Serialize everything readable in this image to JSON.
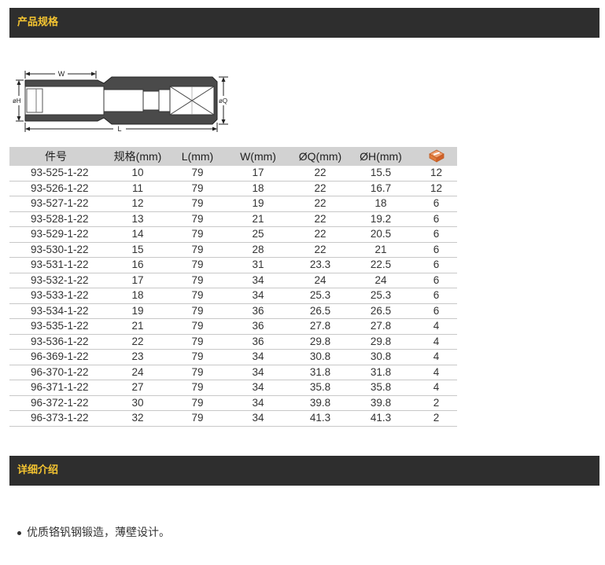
{
  "sections": {
    "spec_title": "产品规格",
    "detail_title": "详细介绍"
  },
  "diagram": {
    "label_w": "W",
    "label_l": "L",
    "label_h": "øH",
    "label_q": "øQ"
  },
  "table": {
    "headers": [
      "件号",
      "规格(mm)",
      "L(mm)",
      "W(mm)",
      "ØQ(mm)",
      "ØH(mm)"
    ],
    "package_icon": "package-box-icon",
    "rows": [
      [
        "93-525-1-22",
        "10",
        "79",
        "17",
        "22",
        "15.5",
        "12"
      ],
      [
        "93-526-1-22",
        "11",
        "79",
        "18",
        "22",
        "16.7",
        "12"
      ],
      [
        "93-527-1-22",
        "12",
        "79",
        "19",
        "22",
        "18",
        "6"
      ],
      [
        "93-528-1-22",
        "13",
        "79",
        "21",
        "22",
        "19.2",
        "6"
      ],
      [
        "93-529-1-22",
        "14",
        "79",
        "25",
        "22",
        "20.5",
        "6"
      ],
      [
        "93-530-1-22",
        "15",
        "79",
        "28",
        "22",
        "21",
        "6"
      ],
      [
        "93-531-1-22",
        "16",
        "79",
        "31",
        "23.3",
        "22.5",
        "6"
      ],
      [
        "93-532-1-22",
        "17",
        "79",
        "34",
        "24",
        "24",
        "6"
      ],
      [
        "93-533-1-22",
        "18",
        "79",
        "34",
        "25.3",
        "25.3",
        "6"
      ],
      [
        "93-534-1-22",
        "19",
        "79",
        "36",
        "26.5",
        "26.5",
        "6"
      ],
      [
        "93-535-1-22",
        "21",
        "79",
        "36",
        "27.8",
        "27.8",
        "4"
      ],
      [
        "93-536-1-22",
        "22",
        "79",
        "36",
        "29.8",
        "29.8",
        "4"
      ],
      [
        "96-369-1-22",
        "23",
        "79",
        "34",
        "30.8",
        "30.8",
        "4"
      ],
      [
        "96-370-1-22",
        "24",
        "79",
        "34",
        "31.8",
        "31.8",
        "4"
      ],
      [
        "96-371-1-22",
        "27",
        "79",
        "34",
        "35.8",
        "35.8",
        "4"
      ],
      [
        "96-372-1-22",
        "30",
        "79",
        "34",
        "39.8",
        "39.8",
        "2"
      ],
      [
        "96-373-1-22",
        "32",
        "79",
        "34",
        "41.3",
        "41.3",
        "2"
      ]
    ]
  },
  "details": {
    "bullet": "优质铬钒钢锻造，薄壁设计。"
  }
}
